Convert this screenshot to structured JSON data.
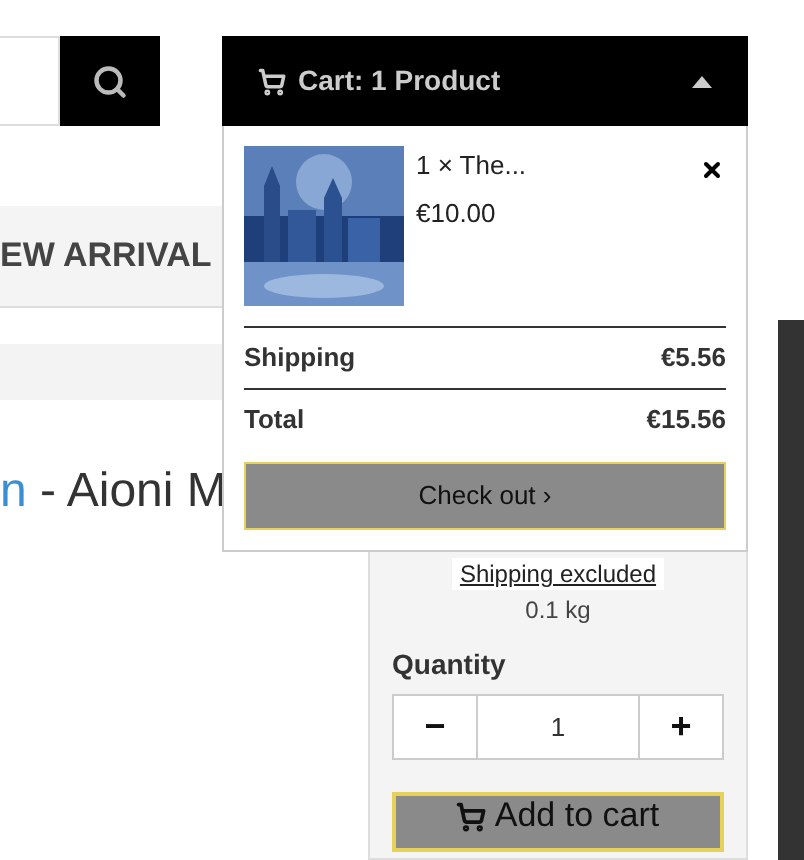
{
  "cart": {
    "label": "Cart: 1 Product",
    "expanded": true,
    "items": [
      {
        "kind": "picture",
        "line": "1 × The...",
        "price": "€10.00"
      }
    ],
    "shipping": {
      "label": "Shipping",
      "value": "€5.56"
    },
    "total": {
      "label": "Total",
      "value": "€15.56"
    },
    "checkout": "Check out ›"
  },
  "nav": {
    "item": "EW ARRIVAL"
  },
  "product": {
    "title_link": "n",
    "title": " - Aioni M",
    "shipping_note": "Shipping excluded",
    "weight": "0.1 kg",
    "quantity_label": "Quantity",
    "decrement": "−",
    "quantity": "1",
    "increment": "+",
    "add_to_cart": "Add to cart"
  }
}
